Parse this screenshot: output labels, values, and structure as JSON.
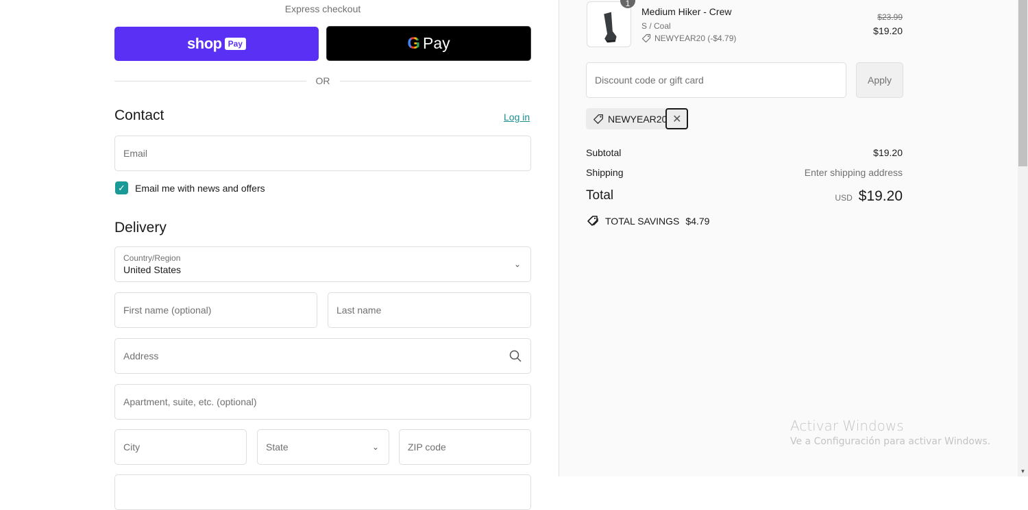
{
  "express": {
    "title": "Express checkout",
    "shop_pay": {
      "shop": "shop",
      "pay": "Pay"
    },
    "gpay": {
      "g": "G",
      "pay": "Pay"
    },
    "or": "OR"
  },
  "contact": {
    "title": "Contact",
    "login": "Log in",
    "email_placeholder": "Email",
    "newsletter_label": "Email me with news and offers",
    "newsletter_checked": true
  },
  "delivery": {
    "title": "Delivery",
    "country_label": "Country/Region",
    "country_value": "United States",
    "first_name_placeholder": "First name (optional)",
    "last_name_placeholder": "Last name",
    "address_placeholder": "Address",
    "apartment_placeholder": "Apartment, suite, etc. (optional)",
    "city_placeholder": "City",
    "state_placeholder": "State",
    "zip_placeholder": "ZIP code"
  },
  "order": {
    "item": {
      "quantity": "1",
      "name": "Medium Hiker - Crew",
      "variant": "S / Coal",
      "discount": "NEWYEAR20 (-$4.79)",
      "original_price": "$23.99",
      "price": "$19.20"
    },
    "discount_placeholder": "Discount code or gift card",
    "apply_label": "Apply",
    "applied_code": "NEWYEAR20",
    "subtotal_label": "Subtotal",
    "subtotal_value": "$19.20",
    "shipping_label": "Shipping",
    "shipping_value": "Enter shipping address",
    "total_label": "Total",
    "total_currency": "USD",
    "total_value": "$19.20",
    "savings_label": "TOTAL SAVINGS",
    "savings_value": "$4.79"
  },
  "watermark": {
    "title": "Activar Windows",
    "subtitle": "Ve a Configuración para activar Windows."
  },
  "colors": {
    "shop_pay": "#5a31f4",
    "accent": "#1a9a96"
  }
}
